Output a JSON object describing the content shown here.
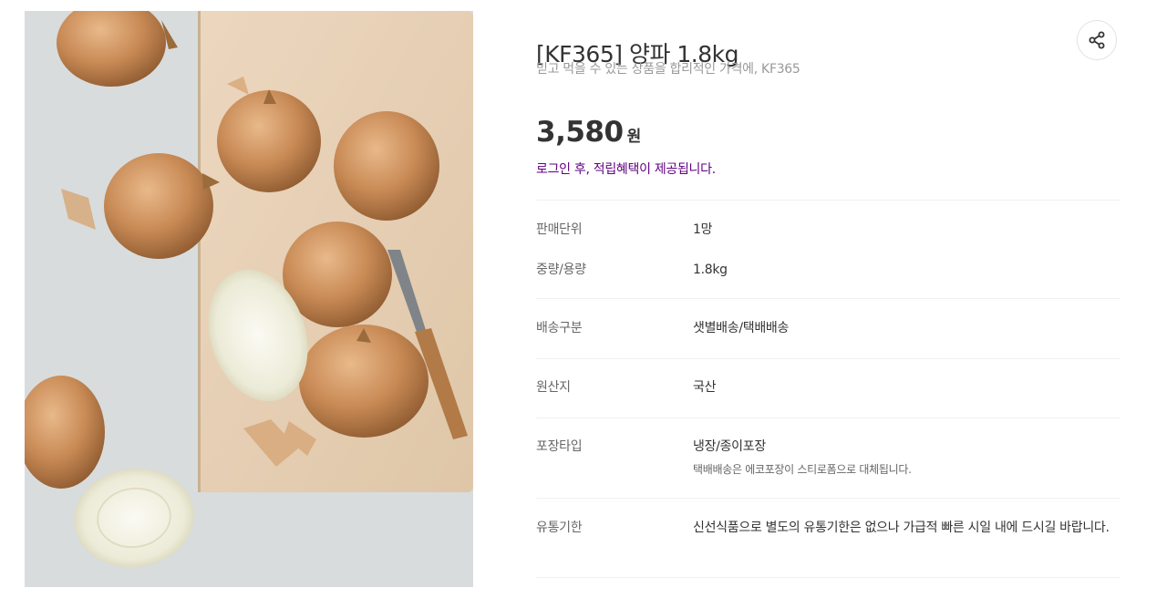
{
  "product": {
    "title": "[KF365] 양파 1.8kg",
    "subtitle": "믿고 먹을 수 있는 상품을 합리적인 가격에, KF365",
    "price": "3,580",
    "price_unit": "원",
    "benefit_notice": "로그인 후, 적립혜택이 제공됩니다.",
    "share_icon": "share-icon",
    "image_icon": "onion-product-photo"
  },
  "details": [
    {
      "label": "판매단위",
      "value": "1망"
    },
    {
      "label": "중량/용량",
      "value": "1.8kg"
    },
    {
      "label": "배송구분",
      "value": "샛별배송/택배배송"
    },
    {
      "label": "원산지",
      "value": "국산"
    },
    {
      "label": "포장타입",
      "value": "냉장/종이포장",
      "note": "택배배송은 에코포장이 스티로폼으로 대체됩니다."
    },
    {
      "label": "유통기한",
      "value": "신선식품으로 별도의 유통기한은 없으나 가급적 빠른 시일 내에 드시길 바랍니다."
    }
  ],
  "colors": {
    "accent": "#5f0080",
    "text": "#333333",
    "muted": "#999999",
    "divider": "#f0f0f0"
  }
}
